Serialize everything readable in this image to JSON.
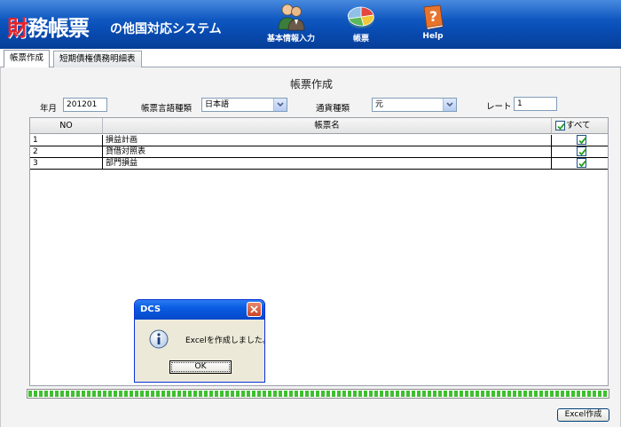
{
  "header": {
    "title_red": "財",
    "title_rest": "務帳票",
    "subtitle": "の他国対応システム",
    "buttons": [
      {
        "label": "基本情報入力",
        "icon": "users-icon"
      },
      {
        "label": "帳票",
        "icon": "pie-chart-icon"
      },
      {
        "label": "Help",
        "icon": "help-book-icon"
      }
    ]
  },
  "tabs": [
    {
      "label": "帳票作成",
      "active": true
    },
    {
      "label": "短期債権債務明細表",
      "active": false
    }
  ],
  "main": {
    "title": "帳票作成",
    "fields": {
      "year_month_label": "年月",
      "year_month_value": "201201",
      "language_label": "帳票言語種類",
      "language_value": "日本語",
      "currency_label": "通貨種類",
      "currency_value": "元",
      "rate_label": "レート",
      "rate_value": "1"
    },
    "grid": {
      "headers": {
        "no": "NO",
        "name": "帳票名",
        "all": "すべて"
      },
      "rows": [
        {
          "no": "1",
          "name": "損益計画",
          "checked": true
        },
        {
          "no": "2",
          "name": "貸借対照表",
          "checked": true
        },
        {
          "no": "3",
          "name": "部門損益",
          "checked": true
        }
      ]
    },
    "progress": 1.0,
    "excel_button": "Excel作成"
  },
  "dialog": {
    "title": "DCS",
    "message": "Excelを作成しました。",
    "ok_label": "OK"
  },
  "colors": {
    "header_blue": "#0a4fb8",
    "title_red": "#e8232a",
    "progress_green": "#3fbf2f",
    "dialog_titlebar": "#0a5ce2"
  }
}
